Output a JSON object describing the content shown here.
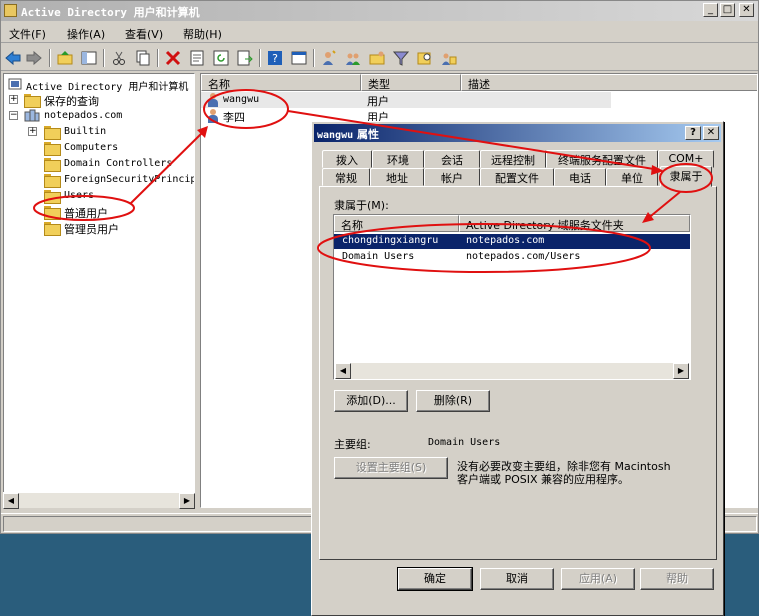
{
  "window": {
    "title": "Active Directory 用户和计算机"
  },
  "menu": [
    "文件(F)",
    "操作(A)",
    "查看(V)",
    "帮助(H)"
  ],
  "tree": {
    "root": "Active Directory 用户和计算机",
    "saved_queries": "保存的查询",
    "domain": "notepados.com",
    "children": [
      "Builtin",
      "Computers",
      "Domain Controllers",
      "ForeignSecurityPrincipals",
      "Users",
      "普通用户",
      "管理员用户"
    ]
  },
  "list": {
    "columns": [
      "名称",
      "类型",
      "描述"
    ],
    "rows": [
      {
        "name": "wangwu",
        "type": "用户"
      },
      {
        "name": "李四",
        "type": "用户"
      }
    ]
  },
  "dialog": {
    "title_user": "wangwu",
    "title_suffix": "属性",
    "help": "?",
    "close": "✕",
    "tabs_row1": [
      "拨入",
      "环境",
      "会话",
      "远程控制",
      "终端服务配置文件",
      "COM+"
    ],
    "tabs_row2": [
      "常规",
      "地址",
      "帐户",
      "配置文件",
      "电话",
      "单位",
      "隶属于"
    ],
    "member_of_label": "隶属于(M):",
    "member_columns": [
      "名称",
      "Active Directory 域服务文件夹"
    ],
    "members": [
      {
        "name": "chongdingxiangru",
        "folder": "notepados.com"
      },
      {
        "name": "Domain Users",
        "folder": "notepados.com/Users"
      }
    ],
    "add_button": "添加(D)...",
    "remove_button": "删除(R)",
    "primary_group_label": "主要组:",
    "primary_group_value": "Domain Users",
    "set_primary_button": "设置主要组(S)",
    "primary_note_line1": "没有必要改变主要组，除非您有 Macintosh",
    "primary_note_line2": "客户端或 POSIX 兼容的应用程序。",
    "ok": "确定",
    "cancel": "取消",
    "apply": "应用(A)",
    "helpbtn": "帮助"
  },
  "colors": {
    "annotation": "#e01010",
    "selection": "#0a246a"
  }
}
